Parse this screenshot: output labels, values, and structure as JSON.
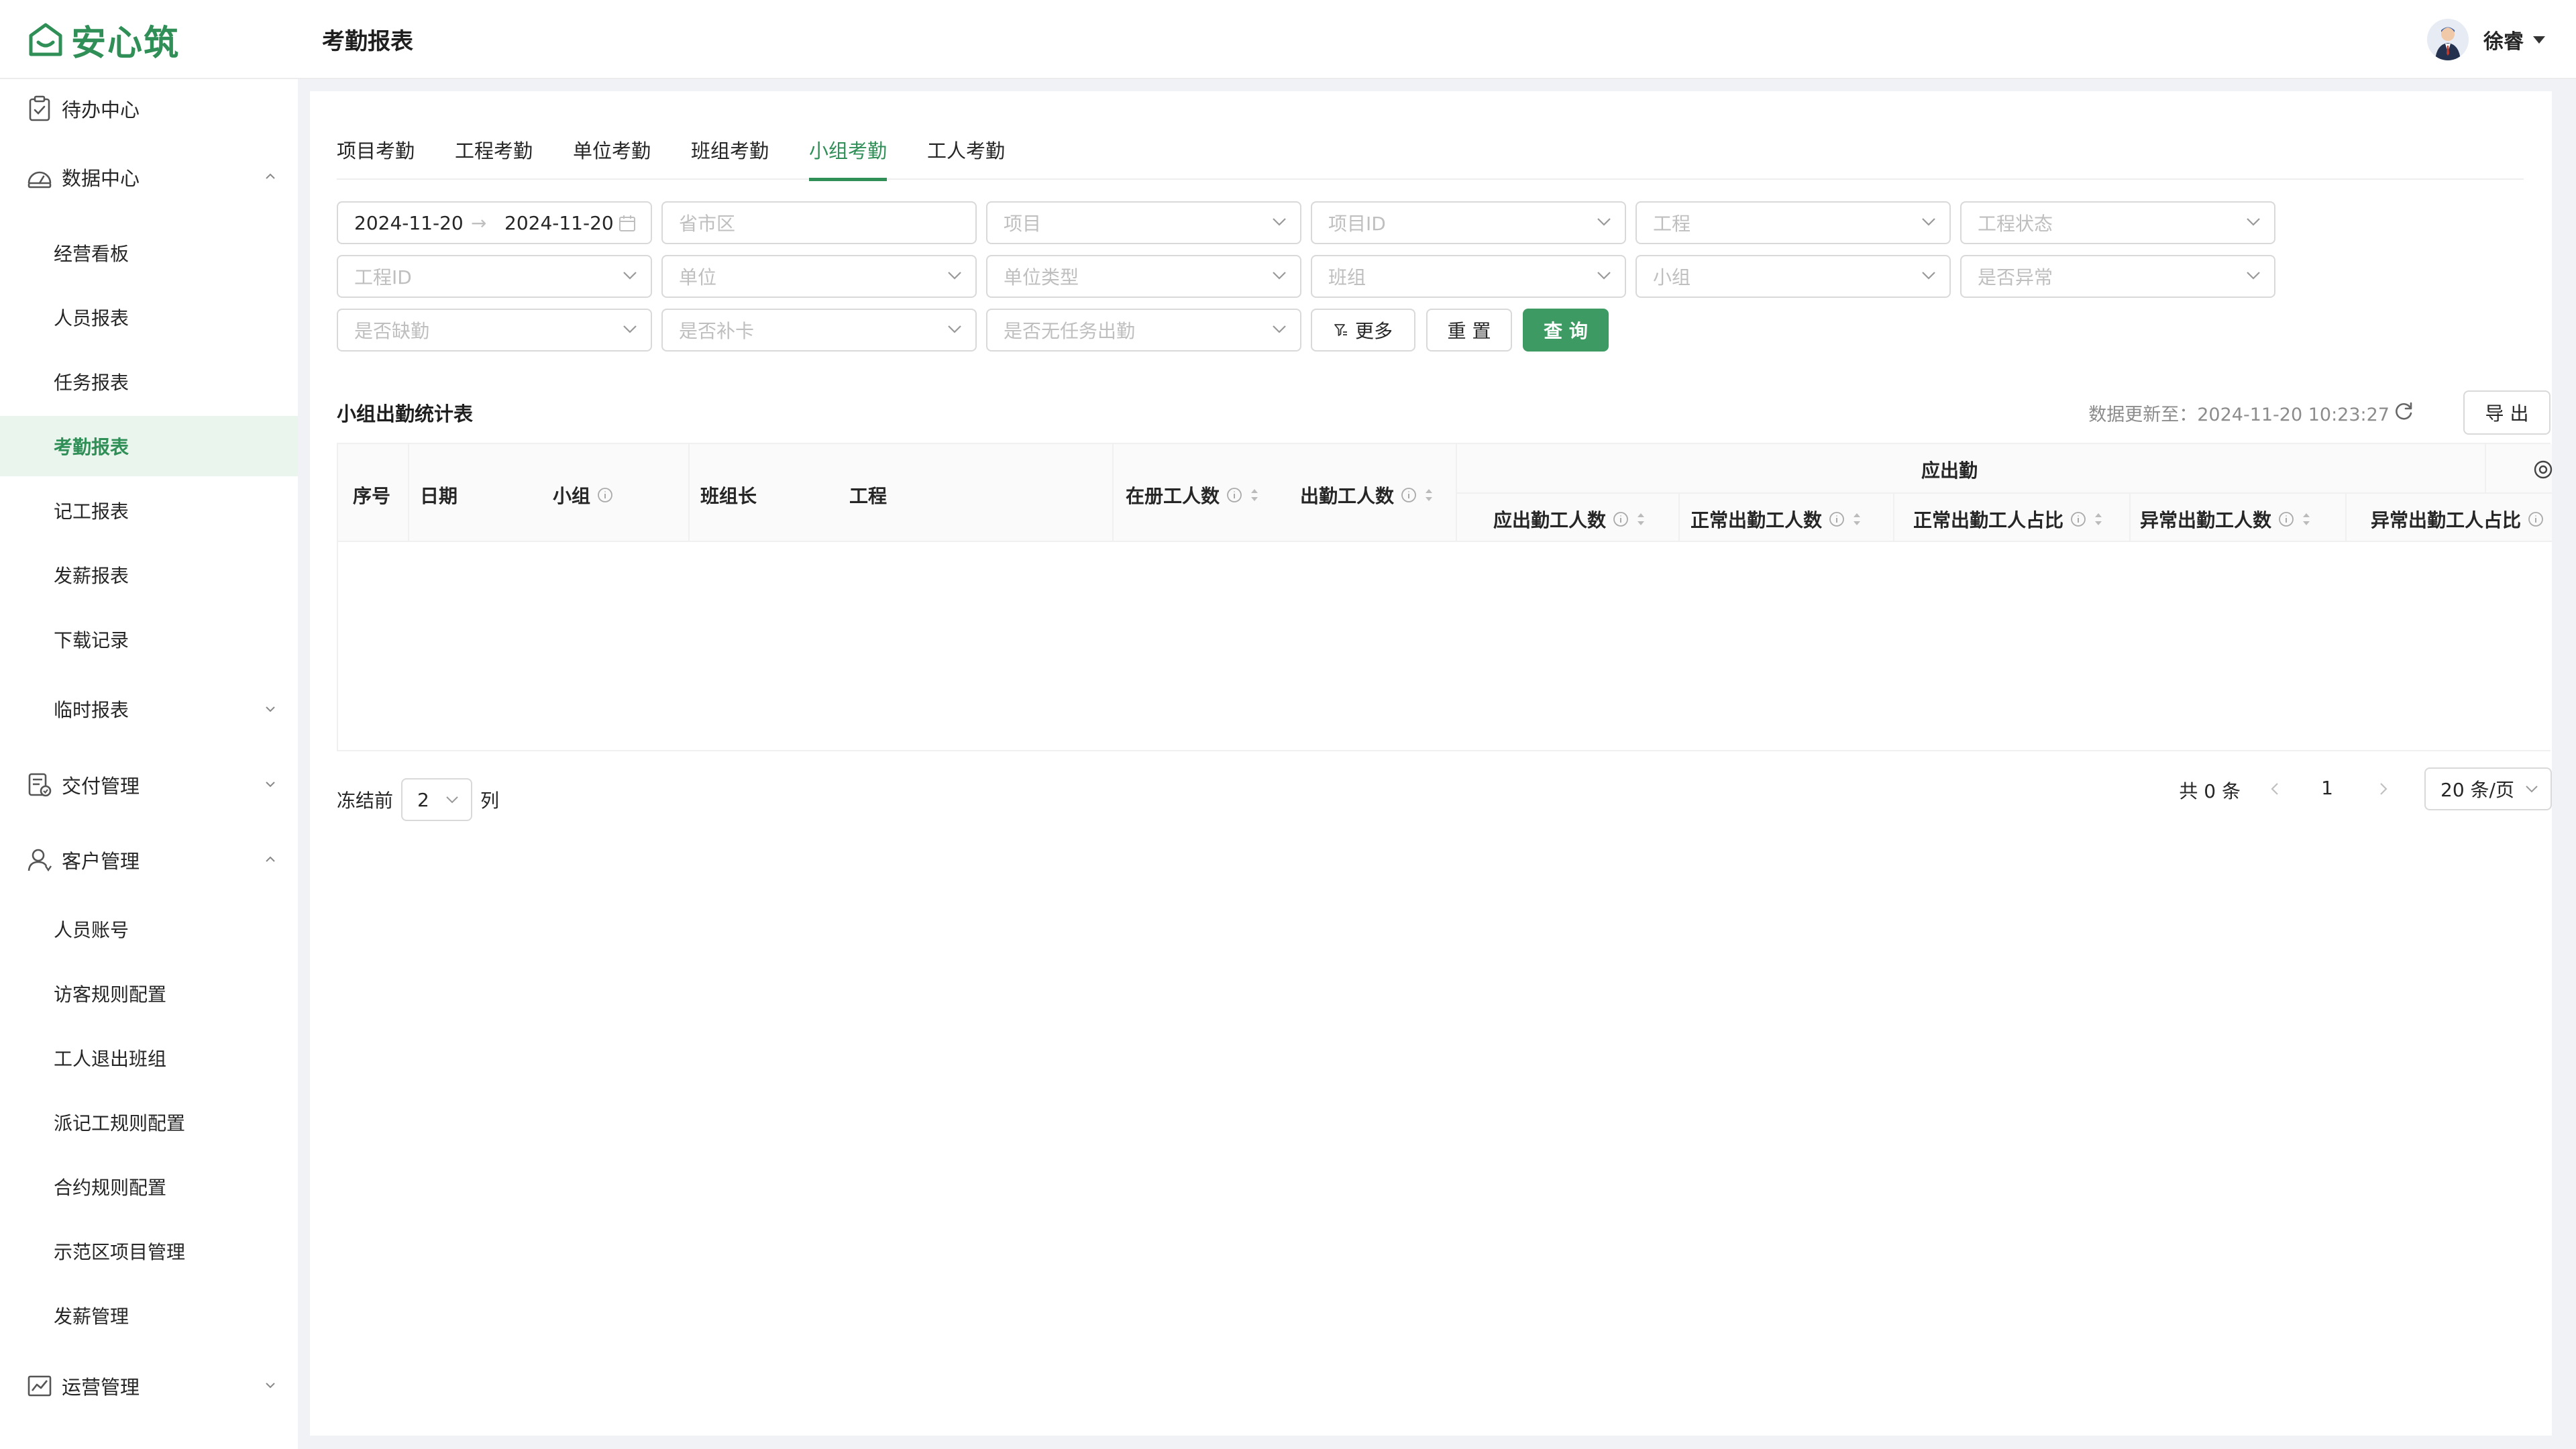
{
  "app": {
    "logo_text": "安心筑",
    "page_title": "考勤报表",
    "user_name": "徐睿"
  },
  "colors": {
    "accent": "#2f8f57",
    "primary_button": "#3d9a62",
    "active_bg": "#eaf5ee"
  },
  "sidebar": {
    "groups": {
      "todo": {
        "label": "待办中心",
        "icon": "clipboard-icon"
      },
      "data": {
        "label": "数据中心",
        "icon": "dashboard-icon",
        "expanded": true
      },
      "delivery": {
        "label": "交付管理",
        "icon": "document-check-icon",
        "expanded": false
      },
      "customer": {
        "label": "客户管理",
        "icon": "user-icon",
        "expanded": true
      },
      "ops": {
        "label": "运营管理",
        "icon": "chart-line-icon",
        "expanded": false
      }
    },
    "data_items": [
      "经营看板",
      "人员报表",
      "任务报表",
      "考勤报表",
      "记工报表",
      "发薪报表",
      "下载记录",
      "临时报表"
    ],
    "customer_items": [
      "人员账号",
      "访客规则配置",
      "工人退出班组",
      "派记工规则配置",
      "合约规则配置",
      "示范区项目管理",
      "发薪管理"
    ],
    "active_item": "考勤报表"
  },
  "tabs": {
    "items": [
      "项目考勤",
      "工程考勤",
      "单位考勤",
      "班组考勤",
      "小组考勤",
      "工人考勤"
    ],
    "active": "小组考勤"
  },
  "filters": {
    "date_start": "2024-11-20",
    "date_arrow": "→",
    "date_end": "2024-11-20",
    "region": "省市区",
    "project": "项目",
    "project_id": "项目ID",
    "engineering": "工程",
    "engineering_status": "工程状态",
    "engineering_id": "工程ID",
    "unit": "单位",
    "unit_type": "单位类型",
    "team": "班组",
    "group": "小组",
    "is_abnormal": "是否异常",
    "is_absent": "是否缺勤",
    "is_makeup": "是否补卡",
    "is_no_task": "是否无任务出勤",
    "more_label": "更多",
    "reset_label": "重 置",
    "query_label": "查 询"
  },
  "table": {
    "title": "小组出勤统计表",
    "update_info": "数据更新至：2024-11-20 10:23:27",
    "export_label": "导 出",
    "columns": {
      "index": "序号",
      "date": "日期",
      "group": "小组",
      "team_leader": "班组长",
      "engineering": "工程",
      "registered": "在册工人数",
      "attended": "出勤工人数",
      "due_group": "应出勤",
      "due_workers": "应出勤工人数",
      "normal_workers": "正常出勤工人数",
      "normal_ratio": "正常出勤工人占比",
      "abnormal_workers": "异常出勤工人数",
      "abnormal_ratio": "异常出勤工人占比"
    },
    "rows": []
  },
  "footer": {
    "freeze_prefix": "冻结前",
    "freeze_value": "2",
    "freeze_suffix": "列",
    "total": "共 0 条",
    "current_page": "1",
    "page_size": "20 条/页"
  }
}
